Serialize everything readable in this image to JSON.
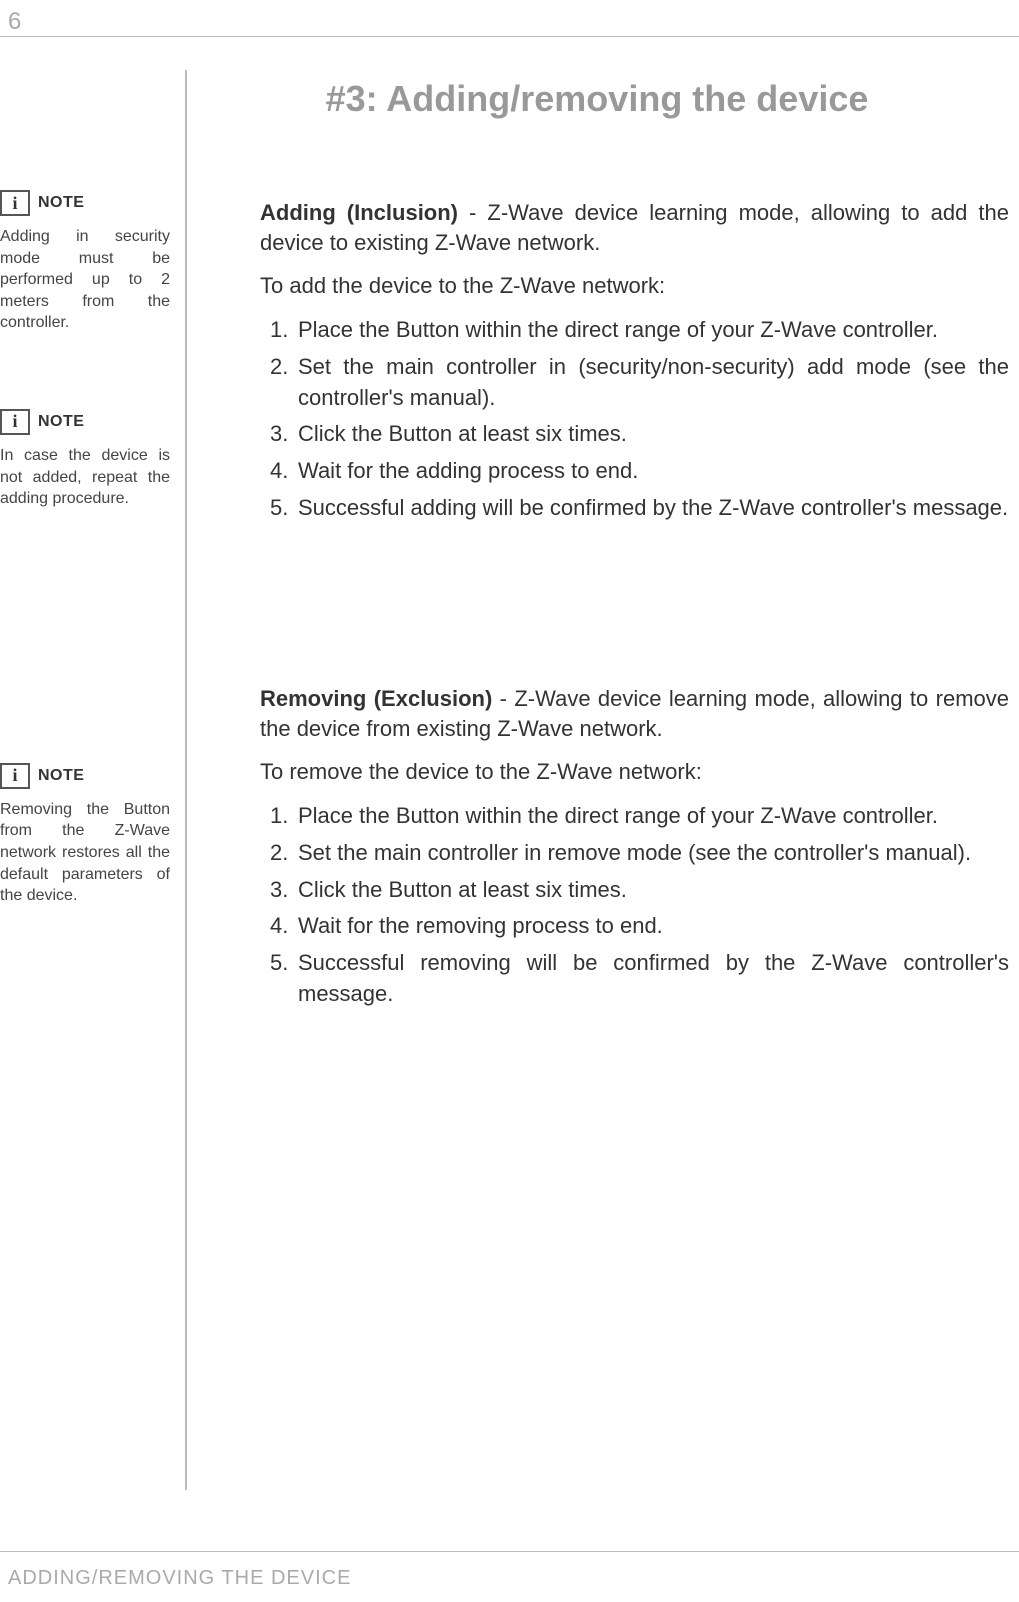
{
  "page": {
    "number": "6",
    "footer": "ADDING/REMOVING THE DEVICE"
  },
  "title": "#3: Adding/removing the device",
  "sidebar": {
    "note_label": "NOTE",
    "notes": [
      {
        "text": "Adding in security mode must be performed up to 2 meters from the controller."
      },
      {
        "text": "In case the device is not added, repeat the adding procedure."
      },
      {
        "text": "Removing the Button from the Z-Wave network restores all the default parameters of the device."
      }
    ]
  },
  "main": {
    "adding": {
      "lead_strong": "Adding (Inclusion)",
      "lead_rest": " - Z-Wave device learning mode, allowing to add the device to existing Z-Wave network.",
      "intro": "To add the device to the Z-Wave network:",
      "steps": [
        "Place the Button within the direct range of your Z-Wave controller.",
        "Set the main controller in (security/non-security) add mode (see the controller's manual).",
        "Click the Button at least six times.",
        "Wait for the adding process to end.",
        "Successful adding will be confirmed by the Z-Wave controller's message."
      ]
    },
    "removing": {
      "lead_strong": "Removing (Exclusion)",
      "lead_rest": " - Z-Wave device learning mode, allowing to remove the device from existing Z-Wave network.",
      "intro": "To remove the device to the Z-Wave network:",
      "steps": [
        "Place the Button within the direct range of your Z-Wave controller.",
        "Set the main controller in remove mode (see the controller's manual).",
        "Click the Button at least six times.",
        "Wait for the removing process to end.",
        "Successful removing will be confirmed by the Z-Wave controller's message."
      ]
    }
  }
}
